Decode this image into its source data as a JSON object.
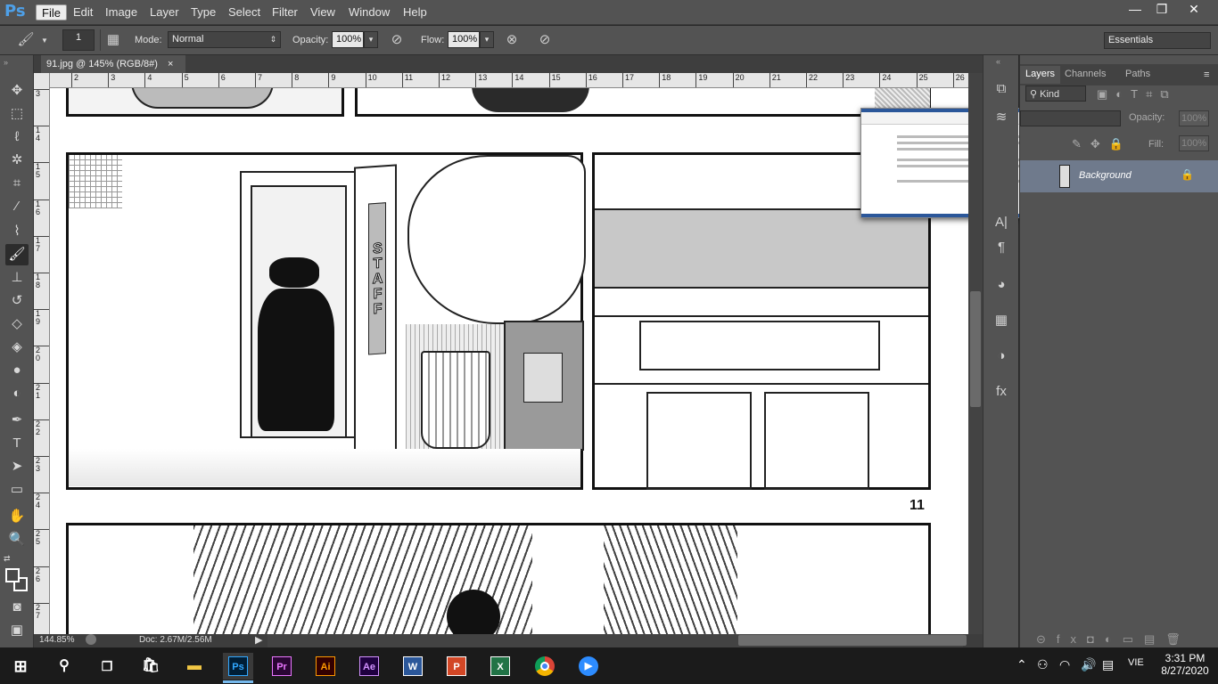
{
  "app": {
    "logo": "Ps",
    "accent": "#31a8ff"
  },
  "menu": [
    "File",
    "Edit",
    "Image",
    "Layer",
    "Type",
    "Select",
    "Filter",
    "View",
    "Window",
    "Help"
  ],
  "window_controls": {
    "minimize": "—",
    "restore": "❐",
    "close": "✕"
  },
  "options": {
    "brush_size": "1",
    "mode_label": "Mode:",
    "mode_value": "Normal",
    "opacity_label": "Opacity:",
    "opacity_value": "100%",
    "flow_label": "Flow:",
    "flow_value": "100%",
    "workspace": "Essentials"
  },
  "document": {
    "tab_title": "91.jpg @ 145% (RGB/8#)",
    "tab_close": "×",
    "zoom": "144.85%",
    "doc_info": "Doc: 2.67M/2.56M",
    "page_number": "11",
    "door_sign": "STAFF",
    "h_ruler": [
      "2",
      "3",
      "4",
      "5",
      "6",
      "7",
      "8",
      "9",
      "10",
      "11",
      "12",
      "13",
      "14",
      "15",
      "16",
      "17",
      "18",
      "19",
      "20",
      "21",
      "22",
      "23",
      "24",
      "25",
      "26"
    ],
    "v_ruler": [
      "3",
      "1 4",
      "1 5",
      "1 6",
      "1 7",
      "1 8",
      "1 9",
      "2 0",
      "2 1",
      "2 2",
      "2 3",
      "2 4",
      "2 5",
      "2 6",
      "2 7"
    ]
  },
  "layers_panel": {
    "tabs": [
      "Layers",
      "Channels",
      "Paths"
    ],
    "filter_kind": "Kind",
    "opacity_label": "Opacity:",
    "opacity_value": "100%",
    "fill_label": "Fill:",
    "fill_value": "100%",
    "layer_name": "Background"
  },
  "taskbar": {
    "apps": [
      {
        "name": "Photoshop",
        "label": "Ps",
        "color": "#31a8ff",
        "bg": "#001e36"
      },
      {
        "name": "Premiere",
        "label": "Pr",
        "color": "#ea77ff",
        "bg": "#2a0634"
      },
      {
        "name": "Illustrator",
        "label": "Ai",
        "color": "#ff9a00",
        "bg": "#330000"
      },
      {
        "name": "After Effects",
        "label": "Ae",
        "color": "#d291ff",
        "bg": "#1f0040"
      },
      {
        "name": "Word",
        "label": "W",
        "color": "#ffffff",
        "bg": "#2b579a"
      },
      {
        "name": "PowerPoint",
        "label": "P",
        "color": "#ffffff",
        "bg": "#d24726"
      },
      {
        "name": "Excel",
        "label": "X",
        "color": "#ffffff",
        "bg": "#217346"
      }
    ],
    "language": "VIE",
    "time": "3:31 PM",
    "date": "8/27/2020"
  }
}
